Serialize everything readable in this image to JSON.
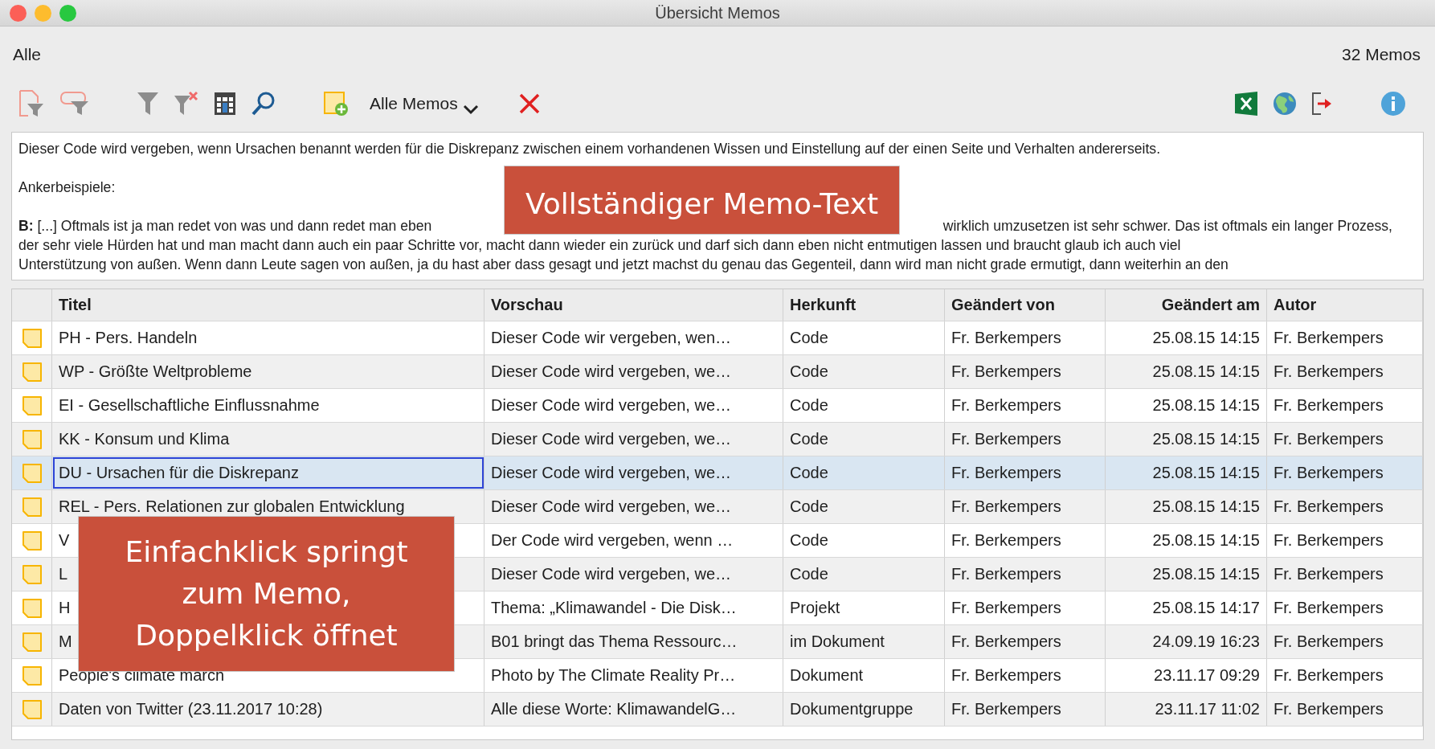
{
  "window": {
    "title": "Übersicht Memos"
  },
  "header": {
    "filter_label": "Alle",
    "count": "32 Memos"
  },
  "toolbar": {
    "dropdown": "Alle Memos"
  },
  "memo_text": {
    "lines": [
      {
        "kind": "text",
        "text": "Dieser Code wird vergeben, wenn Ursachen benannt werden für die Diskrepanz zwischen einem vorhandenen Wissen und Einstellung auf der einen Seite und Verhalten andererseits."
      },
      {
        "kind": "blank"
      },
      {
        "kind": "text",
        "text": "Ankerbeispiele:"
      },
      {
        "kind": "blank"
      },
      {
        "kind": "split",
        "text": "**B:** [...] Oftmals ist ja man redet von was und dann redet man eben",
        "text_right": "wirklich umzusetzen ist sehr schwer. Das ist oftmals ein langer Prozess,"
      },
      {
        "kind": "text",
        "text": "der sehr viele Hürden hat und man macht dann auch ein paar Schritte vor, macht dann wieder ein zurück und darf sich dann eben nicht entmutigen lassen und braucht glaub ich auch viel"
      },
      {
        "kind": "text",
        "text": "Unterstützung von außen. Wenn dann Leute sagen von außen, ja du hast aber dass gesagt und jetzt machst du genau das Gegenteil, dann wird man nicht grade ermutigt, dann weiterhin an den"
      }
    ]
  },
  "table": {
    "columns": [
      {
        "label": "Titel"
      },
      {
        "label": "Vorschau"
      },
      {
        "label": "Herkunft"
      },
      {
        "label": "Geändert von"
      },
      {
        "label": "Geändert am"
      },
      {
        "label": "Autor"
      }
    ],
    "rows": [
      {
        "selected": false,
        "cells": [
          "PH - Pers. Handeln",
          "Dieser Code wir vergeben, wen…",
          "Code",
          "Fr. Berkempers",
          "25.08.15 14:15",
          "Fr. Berkempers"
        ]
      },
      {
        "selected": false,
        "cells": [
          "WP - Größte Weltprobleme",
          "Dieser Code wird vergeben, we…",
          "Code",
          "Fr. Berkempers",
          "25.08.15 14:15",
          "Fr. Berkempers"
        ]
      },
      {
        "selected": false,
        "cells": [
          "EI - Gesellschaftliche Einflussnahme",
          "Dieser Code wird vergeben, we…",
          "Code",
          "Fr. Berkempers",
          "25.08.15 14:15",
          "Fr. Berkempers"
        ]
      },
      {
        "selected": false,
        "cells": [
          "KK - Konsum und Klima",
          "Dieser Code wird vergeben, we…",
          "Code",
          "Fr. Berkempers",
          "25.08.15 14:15",
          "Fr. Berkempers"
        ]
      },
      {
        "selected": true,
        "cells": [
          "DU - Ursachen für die Diskrepanz",
          "Dieser Code wird vergeben, we…",
          "Code",
          "Fr. Berkempers",
          "25.08.15 14:15",
          "Fr. Berkempers"
        ]
      },
      {
        "selected": false,
        "cells": [
          "REL - Pers. Relationen zur globalen Entwicklung",
          "Dieser Code wird vergeben, we…",
          "Code",
          "Fr. Berkempers",
          "25.08.15 14:15",
          "Fr. Berkempers"
        ]
      },
      {
        "selected": false,
        "cells": [
          "V",
          "Der Code wird vergeben, wenn …",
          "Code",
          "Fr. Berkempers",
          "25.08.15 14:15",
          "Fr. Berkempers"
        ]
      },
      {
        "selected": false,
        "cells": [
          "L",
          "Dieser Code wird vergeben, we…",
          "Code",
          "Fr. Berkempers",
          "25.08.15 14:15",
          "Fr. Berkempers"
        ]
      },
      {
        "selected": false,
        "cells": [
          "H",
          "Thema: „Klimawandel - Die Disk…",
          "Projekt",
          "Fr. Berkempers",
          "25.08.15 14:17",
          "Fr. Berkempers"
        ]
      },
      {
        "selected": false,
        "cells": [
          "M",
          "B01 bringt das Thema Ressourc…",
          "im Dokument",
          "Fr. Berkempers",
          "24.09.19 16:23",
          "Fr. Berkempers"
        ]
      },
      {
        "selected": false,
        "cells": [
          "People's climate march",
          "Photo by The Climate Reality Pr…",
          "Dokument",
          "Fr. Berkempers",
          "23.11.17 09:29",
          "Fr. Berkempers"
        ]
      },
      {
        "selected": false,
        "cells": [
          "Daten von Twitter (23.11.2017 10:28)",
          "Alle diese Worte: KlimawandelG…",
          "Dokumentgruppe",
          "Fr. Berkempers",
          "23.11.17 11:02",
          "Fr. Berkempers"
        ]
      }
    ]
  },
  "callouts": [
    {
      "kind": "memo",
      "text": "Vollständiger Memo-Text"
    },
    {
      "kind": "table",
      "text": "Einfachklick springt\nzum Memo,\nDoppelklick öffnet"
    }
  ]
}
